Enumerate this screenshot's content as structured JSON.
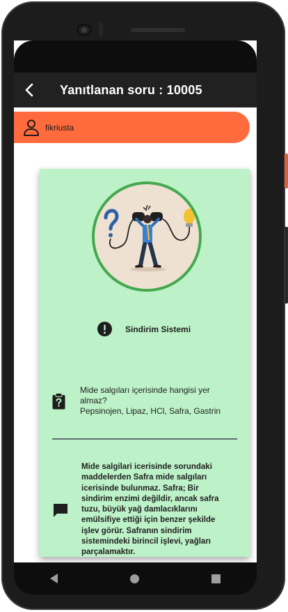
{
  "header": {
    "title": "Yanıtlanan soru : 10005",
    "back_icon": "arrow-back-icon"
  },
  "user": {
    "name": "fikriusta",
    "icon": "person-icon",
    "bar_color": "#ff6b3d"
  },
  "card": {
    "background": "#bdf2c8",
    "illustration": "man-connecting-plugs-question-lightbulb-illustration",
    "topic_icon": "alert-circle-icon",
    "topic": "Sindirim Sistemi",
    "question_icon": "clipboard-question-icon",
    "question": "Mide salgıları içerisinde hangisi yer almaz?",
    "options": "Pepsinojen, Lipaz, HCl, Safra, Gastrin",
    "answer_icon": "comment-icon",
    "answer": "Mide salgilari icerisinde sorundaki maddelerden Safra mide salgıları icerisinde bulunmaz. Safra; Bir sindirim enzimi değildir, ancak safra tuzu, büyük yağ damlacıklarını emülsifiye ettiği için benzer şekilde işlev görür. Safranın sindirim sistemindeki birincil işlevi, yağları parçalamaktır."
  },
  "navbar": {
    "back": "nav-back-icon",
    "home": "nav-home-icon",
    "recents": "nav-recents-icon"
  }
}
